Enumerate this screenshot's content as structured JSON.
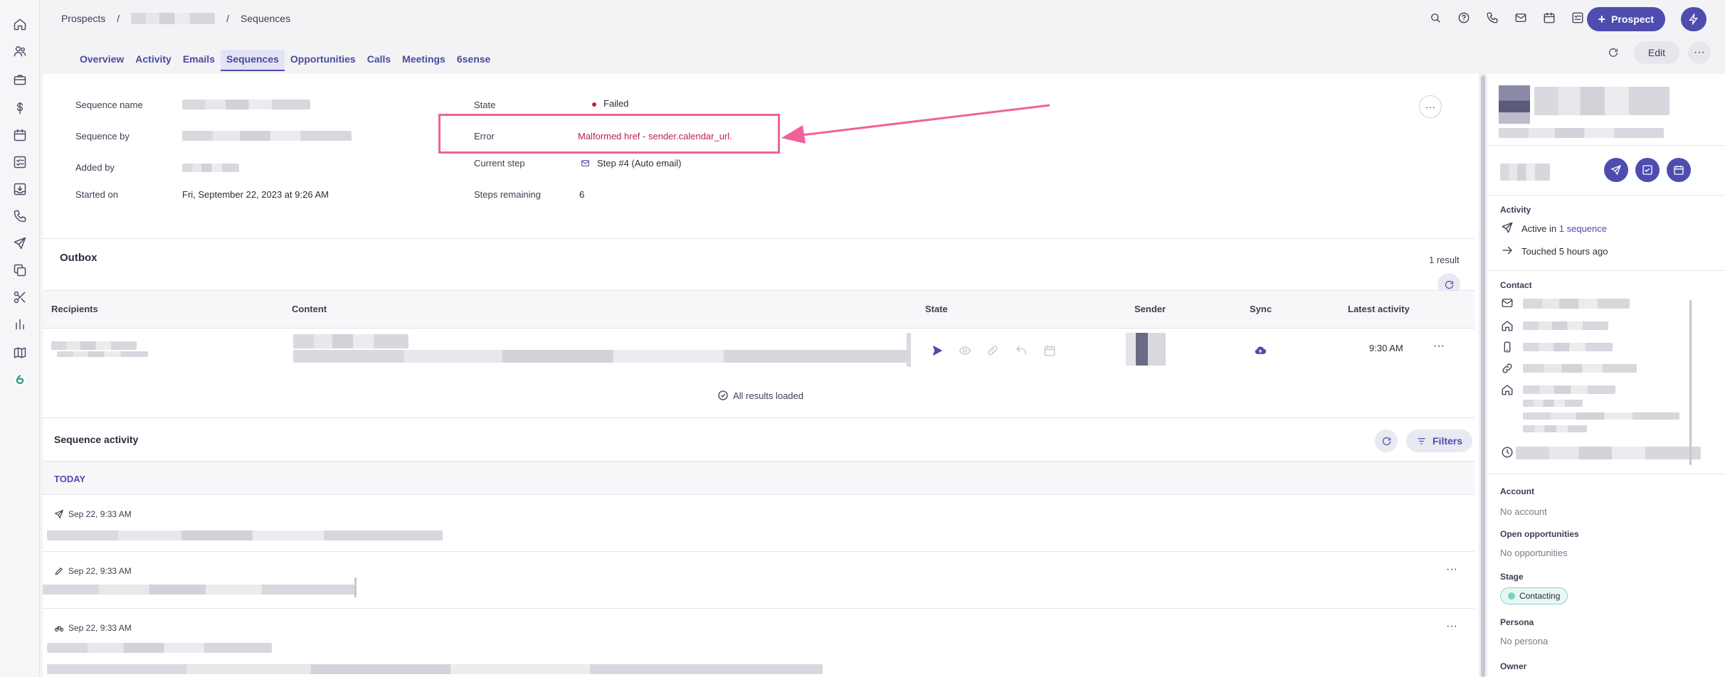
{
  "breadcrumb": {
    "root": "Prospects",
    "separator": "/",
    "current": "Sequences"
  },
  "header": {
    "prospect_button": "Prospect",
    "edit_button": "Edit",
    "more_button": "···"
  },
  "tabs": [
    "Overview",
    "Activity",
    "Emails",
    "Sequences",
    "Opportunities",
    "Calls",
    "Meetings",
    "6sense"
  ],
  "active_tab": "Sequences",
  "details": {
    "sequence_name_label": "Sequence name",
    "sequence_by_label": "Sequence by",
    "added_by_label": "Added by",
    "started_on_label": "Started on",
    "started_on_value": "Fri, September 22, 2023 at 9:26 AM",
    "state_label": "State",
    "state_value": "Failed",
    "error_label": "Error",
    "error_value": "Malformed href - sender.calendar_url.",
    "current_step_label": "Current step",
    "current_step_value": "Step #4 (Auto email)",
    "steps_remaining_label": "Steps remaining",
    "steps_remaining_value": "6",
    "more": "···"
  },
  "outbox": {
    "title": "Outbox",
    "result_count": "1 result",
    "columns": {
      "recipients": "Recipients",
      "content": "Content",
      "state": "State",
      "sender": "Sender",
      "sync": "Sync",
      "latest_activity": "Latest activity"
    },
    "row": {
      "latest_activity": "9:30 AM",
      "more": "···"
    },
    "all_loaded": "All results loaded"
  },
  "sequence_activity": {
    "title": "Sequence activity",
    "filters_button": "Filters",
    "group_label": "TODAY",
    "items": [
      {
        "date": "Sep 22, 9:33 AM",
        "icon": "send-icon"
      },
      {
        "date": "Sep 22, 9:33 AM",
        "icon": "pencil-icon",
        "more": "···"
      },
      {
        "date": "Sep 22, 9:33 AM",
        "icon": "bike-icon",
        "more": "···"
      }
    ]
  },
  "sidebar": {
    "activity_title": "Activity",
    "active_in_prefix": "Active in",
    "active_in_link": "1 sequence",
    "touched": "Touched 5 hours ago",
    "contact_title": "Contact",
    "account_title": "Account",
    "account_value": "No account",
    "opportunities_title": "Open opportunities",
    "opportunities_value": "No opportunities",
    "stage_title": "Stage",
    "stage_value": "Contacting",
    "persona_title": "Persona",
    "persona_value": "No persona",
    "owner_title": "Owner"
  },
  "colors": {
    "accent": "#4f4cb0",
    "error": "#b7254a",
    "highlight": "#f0629c",
    "stage": "#74d4c2"
  }
}
